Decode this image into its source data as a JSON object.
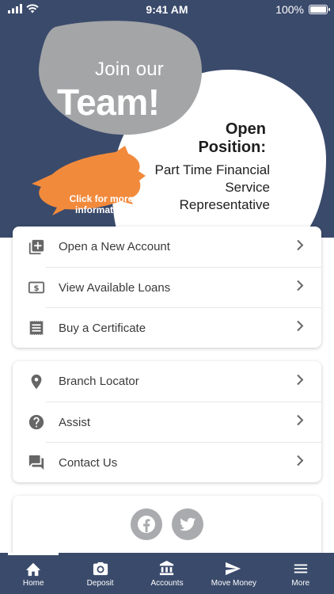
{
  "status_bar": {
    "time": "9:41 AM",
    "battery": "100%"
  },
  "banner": {
    "join_line1": "Join our",
    "join_line2": "Team!",
    "open_position": "Open Position:",
    "position_title": "Part Time Financial Service Representative",
    "cta": "Click for more information",
    "colors": {
      "background": "#3a4a6b",
      "gray_blob": "#a3a5a7",
      "white_blob": "#ffffff",
      "orange_splash": "#f28a3c"
    }
  },
  "account_menu": {
    "items": [
      {
        "label": "Open a New Account",
        "icon": "add-box-icon"
      },
      {
        "label": "View Available Loans",
        "icon": "dollar-bill-icon"
      },
      {
        "label": "Buy a Certificate",
        "icon": "receipt-icon"
      }
    ]
  },
  "support_menu": {
    "items": [
      {
        "label": "Branch Locator",
        "icon": "location-pin-icon"
      },
      {
        "label": "Assist",
        "icon": "help-circle-icon"
      },
      {
        "label": "Contact Us",
        "icon": "chat-icon"
      }
    ]
  },
  "social": [
    {
      "icon": "facebook-icon"
    },
    {
      "icon": "twitter-icon"
    }
  ],
  "tabbar": {
    "tabs": [
      {
        "label": "Home",
        "icon": "home-icon",
        "active": true
      },
      {
        "label": "Deposit",
        "icon": "camera-icon"
      },
      {
        "label": "Accounts",
        "icon": "bank-icon"
      },
      {
        "label": "Move Money",
        "icon": "send-icon"
      },
      {
        "label": "More",
        "icon": "menu-icon"
      }
    ]
  }
}
